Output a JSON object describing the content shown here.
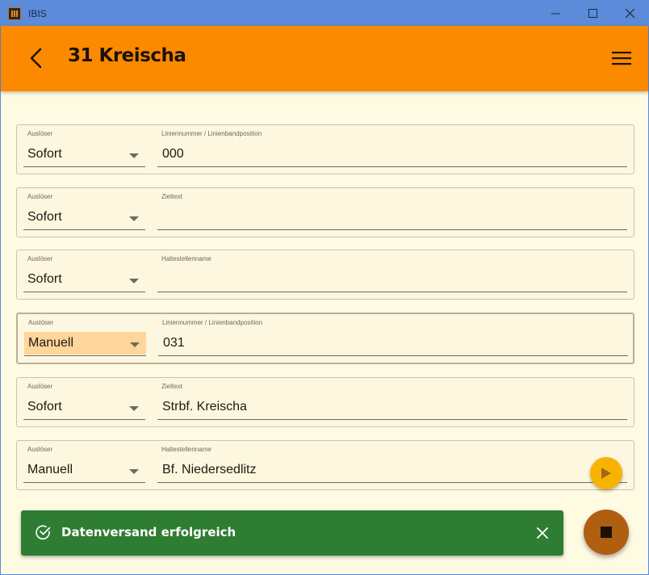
{
  "window": {
    "title": "IBIS",
    "minimize_glyph": "—",
    "maximize_glyph": "☐",
    "close_glyph": "✕"
  },
  "appbar": {
    "title": "31 Kreischa",
    "back_icon": "chevron-left-icon",
    "menu_icon": "hamburger-menu-icon"
  },
  "rows": [
    {
      "trigger_label": "Auslöser",
      "trigger_value": "Sofort",
      "field_label": "Liniennummer / Linienbandposition",
      "field_value": "000"
    },
    {
      "trigger_label": "Auslöser",
      "trigger_value": "Sofort",
      "field_label": "Zieltext",
      "field_value": ""
    },
    {
      "trigger_label": "Auslöser",
      "trigger_value": "Sofort",
      "field_label": "Haltestellenname",
      "field_value": ""
    },
    {
      "trigger_label": "Auslöser",
      "trigger_value": "Manuell",
      "field_label": "Liniennummer / Linienbandposition",
      "field_value": "031"
    },
    {
      "trigger_label": "Auslöser",
      "trigger_value": "Sofort",
      "field_label": "Zieltext",
      "field_value": "Strbf. Kreischa"
    },
    {
      "trigger_label": "Auslöser",
      "trigger_value": "Manuell",
      "field_label": "Haltestellenname",
      "field_value": "Bf. Niedersedlitz"
    }
  ],
  "snackbar": {
    "message": "Datenversand erfolgreich",
    "status_icon": "check-circle-icon",
    "close_icon": "close-icon"
  },
  "fabs": {
    "play_icon": "play-icon",
    "stop_icon": "stop-icon"
  },
  "colors": {
    "titlebar": "#5b8bd9",
    "appbar": "#fb8a00",
    "background": "#fffbe3",
    "snackbar": "#2e7d32",
    "play_fab": "#f6b400",
    "stop_fab": "#b05e10",
    "highlight": "#fed59a"
  }
}
